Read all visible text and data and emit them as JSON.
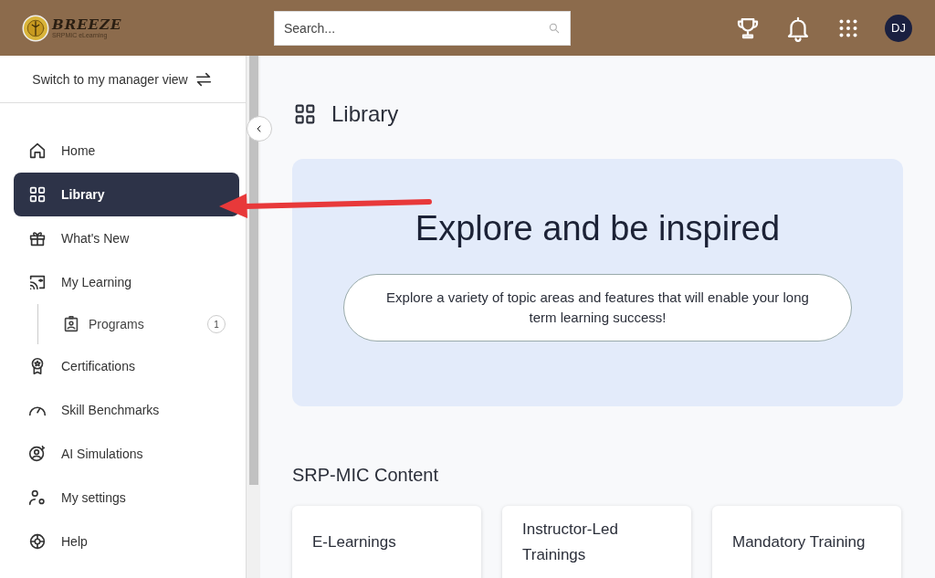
{
  "header": {
    "logo_title": "BREEZE",
    "logo_subtitle": "SRPMIC eLearning",
    "search": {
      "placeholder": "Search..."
    },
    "avatar": "DJ"
  },
  "sidebar": {
    "switch_view": "Switch to my manager view",
    "items": [
      {
        "label": "Home",
        "selected": false
      },
      {
        "label": "Library",
        "selected": true
      },
      {
        "label": "What's New",
        "selected": false
      },
      {
        "label": "My Learning",
        "selected": false,
        "children": [
          {
            "label": "Programs",
            "selected": false,
            "badge": "1"
          }
        ]
      },
      {
        "label": "Certifications",
        "selected": false
      },
      {
        "label": "Skill Benchmarks",
        "selected": false
      },
      {
        "label": "AI Simulations",
        "selected": false
      },
      {
        "label": "My settings",
        "selected": false
      },
      {
        "label": "Help",
        "selected": false
      }
    ]
  },
  "main": {
    "title": "Library",
    "hero": {
      "heading": "Explore and be inspired",
      "text": "Explore a variety of topic areas and features that will enable your long term learning success!"
    },
    "section_title": "SRP-MIC Content",
    "cards": [
      "E-Learnings",
      "Instructor-Led Trainings",
      "Mandatory Training"
    ]
  }
}
